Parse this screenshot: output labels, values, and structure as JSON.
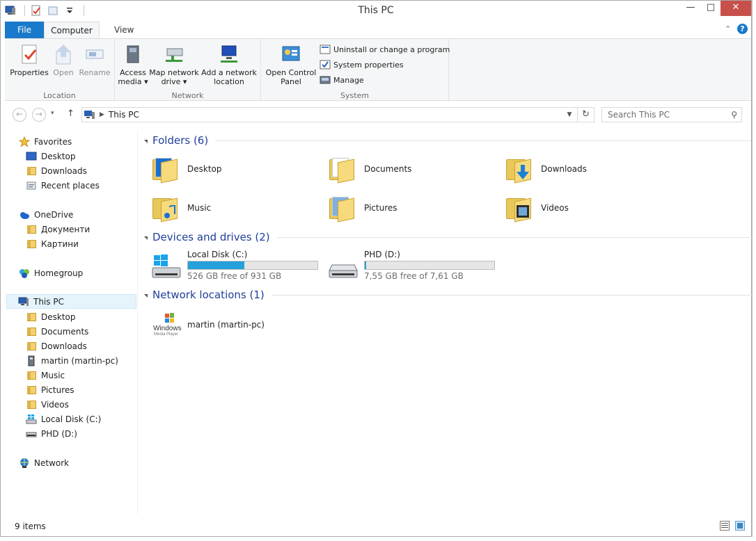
{
  "window": {
    "title": "This PC"
  },
  "ribbon": {
    "tabs": [
      {
        "label": "File"
      },
      {
        "label": "Computer"
      },
      {
        "label": "View"
      }
    ],
    "groups": {
      "location": {
        "label": "Location",
        "buttons": [
          {
            "label": "Properties",
            "enabled": true
          },
          {
            "label": "Open",
            "enabled": false
          },
          {
            "label": "Rename",
            "enabled": false
          }
        ]
      },
      "network": {
        "label": "Network",
        "access_media": {
          "line1": "Access",
          "line2": "media"
        },
        "map_drive": {
          "line1": "Map network",
          "line2": "drive"
        },
        "add_location": {
          "line1": "Add a network",
          "line2": "location"
        }
      },
      "system": {
        "label": "System",
        "control_panel": {
          "line1": "Open Control",
          "line2": "Panel"
        },
        "items": [
          {
            "label": "Uninstall or change a program"
          },
          {
            "label": "System properties"
          },
          {
            "label": "Manage"
          }
        ]
      }
    }
  },
  "addressbar": {
    "path": "This PC",
    "search_placeholder": "Search This PC"
  },
  "navpane": {
    "favorites": {
      "label": "Favorites",
      "items": [
        {
          "label": "Desktop"
        },
        {
          "label": "Downloads"
        },
        {
          "label": "Recent places"
        }
      ]
    },
    "onedrive": {
      "label": "OneDrive",
      "items": [
        {
          "label": "Документи"
        },
        {
          "label": "Картини"
        }
      ]
    },
    "homegroup": {
      "label": "Homegroup"
    },
    "thispc": {
      "label": "This PC",
      "items": [
        {
          "label": "Desktop"
        },
        {
          "label": "Documents"
        },
        {
          "label": "Downloads"
        },
        {
          "label": "martin (martin-pc)"
        },
        {
          "label": "Music"
        },
        {
          "label": "Pictures"
        },
        {
          "label": "Videos"
        },
        {
          "label": "Local Disk (C:)"
        },
        {
          "label": "PHD (D:)"
        }
      ]
    },
    "network": {
      "label": "Network"
    }
  },
  "content": {
    "folders_header": "Folders (6)",
    "folders": [
      {
        "name": "Desktop"
      },
      {
        "name": "Documents"
      },
      {
        "name": "Downloads"
      },
      {
        "name": "Music"
      },
      {
        "name": "Pictures"
      },
      {
        "name": "Videos"
      }
    ],
    "devices_header": "Devices and drives (2)",
    "drives": [
      {
        "name": "Local Disk (C:)",
        "free_text": "526 GB free of 931 GB",
        "used_fraction": 0.435
      },
      {
        "name": "PHD (D:)",
        "free_text": "7,55 GB free of 7,61 GB",
        "used_fraction": 0.008
      }
    ],
    "network_header": "Network locations (1)",
    "network_locations": [
      {
        "name": "martin (martin-pc)",
        "logo_text": "Windows",
        "logo_sub": "Media Player"
      }
    ]
  },
  "statusbar": {
    "items": "9 items"
  },
  "colors": {
    "accent": "#1979ca",
    "selection": "#e5f3fb",
    "drive_fill": "#26a0da",
    "close": "#c7504b"
  }
}
